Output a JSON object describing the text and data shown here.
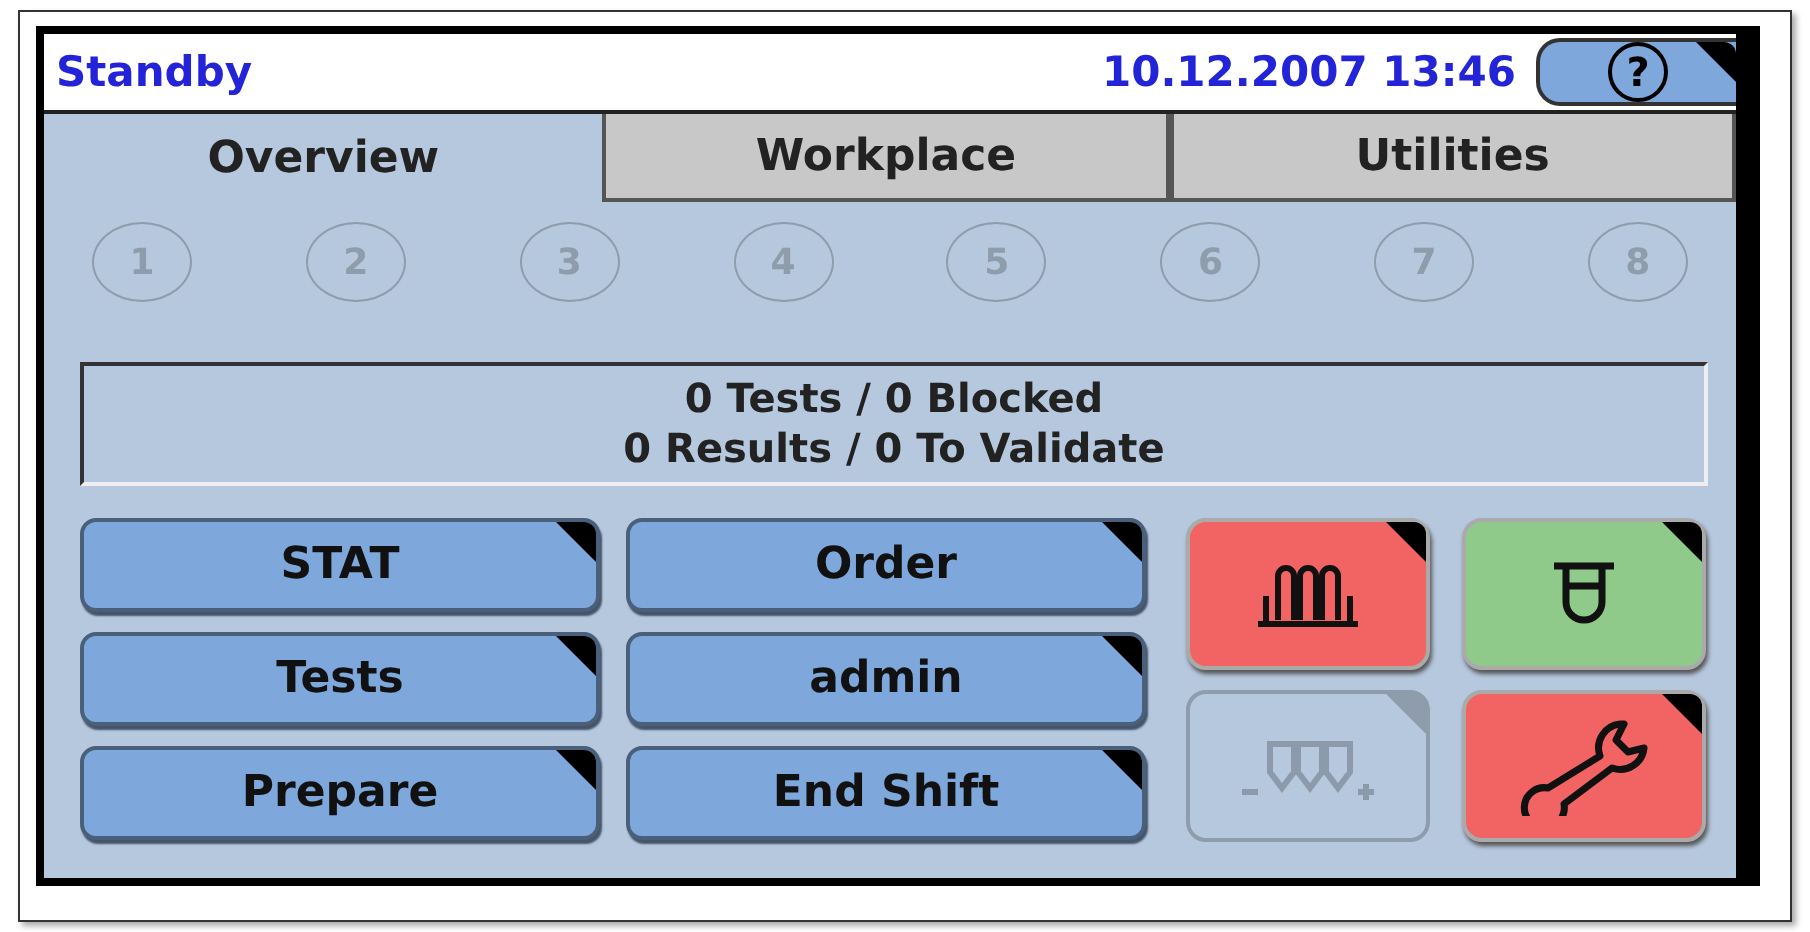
{
  "header": {
    "status": "Standby",
    "datetime": "10.12.2007 13:46",
    "help_button": "?"
  },
  "tabs": [
    {
      "label": "Overview",
      "selected": true
    },
    {
      "label": "Workplace",
      "selected": false
    },
    {
      "label": "Utilities",
      "selected": false
    }
  ],
  "positions": [
    {
      "label": "1",
      "disabled": true
    },
    {
      "label": "2",
      "disabled": true
    },
    {
      "label": "3",
      "disabled": true
    },
    {
      "label": "4",
      "disabled": true
    },
    {
      "label": "5",
      "disabled": true
    },
    {
      "label": "6",
      "disabled": true
    },
    {
      "label": "7",
      "disabled": true
    },
    {
      "label": "8",
      "disabled": true
    }
  ],
  "summary": [
    "0 Tests / 0 Blocked",
    "0 Results / 0 To Validate"
  ],
  "buttons": [
    "STAT",
    "Order",
    "Tests",
    "admin",
    "Prepare",
    "End Shift"
  ],
  "tools": [
    {
      "kind": "rack",
      "color": "#f26463",
      "disabled": false
    },
    {
      "kind": "tube",
      "color": "#8fca8a",
      "disabled": false
    },
    {
      "kind": "load",
      "color": "#b6c8de",
      "disabled": true
    },
    {
      "kind": "wrench",
      "color": "#f26463",
      "disabled": false
    }
  ]
}
